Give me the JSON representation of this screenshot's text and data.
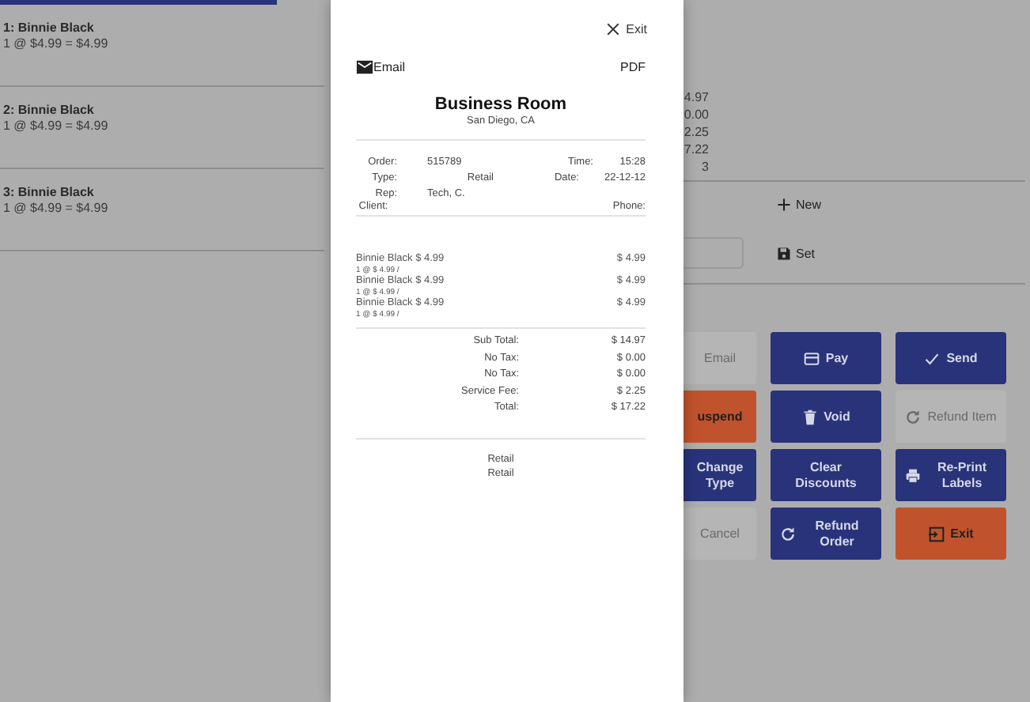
{
  "order_lines": [
    {
      "title": "1: Binnie Black",
      "detail": "1 @ $4.99 = $4.99"
    },
    {
      "title": "2: Binnie Black",
      "detail": "1 @ $4.99 = $4.99"
    },
    {
      "title": "3: Binnie Black",
      "detail": "1 @ $4.99 = $4.99"
    }
  ],
  "summary_values": [
    "4.97",
    "0.00",
    "2.25",
    "7.22",
    "3"
  ],
  "new_action": {
    "label": "New"
  },
  "discount_field": {
    "set_label": "Set"
  },
  "buttons": [
    {
      "label": "Email",
      "kind": "neutral",
      "disabled": true
    },
    {
      "label": "Pay",
      "kind": "primary",
      "disabled": false
    },
    {
      "label": "Send",
      "kind": "primary",
      "disabled": false
    },
    {
      "label": "uspend",
      "kind": "warning",
      "disabled": false
    },
    {
      "label": "Void",
      "kind": "primary",
      "disabled": false
    },
    {
      "label": "Refund Item",
      "kind": "neutral",
      "disabled": true
    },
    {
      "label": "Change Type",
      "kind": "primary",
      "disabled": false
    },
    {
      "label": "Clear Discounts",
      "kind": "primary",
      "disabled": false
    },
    {
      "label": "Re-Print Labels",
      "kind": "primary",
      "disabled": false
    },
    {
      "label": "Cancel",
      "kind": "neutral",
      "disabled": true
    },
    {
      "label": "Refund Order",
      "kind": "primary",
      "disabled": false
    },
    {
      "label": "Exit",
      "kind": "warning",
      "disabled": false
    }
  ],
  "receipt": {
    "close_label": "Exit",
    "email_label": "Email",
    "pdf_label": "PDF",
    "business": "Business Room",
    "location": "San Diego, CA",
    "info_rows": [
      [
        {
          "label": "Order:",
          "value": "515789"
        },
        {
          "label": "Time:",
          "value": "15:28"
        }
      ],
      [
        {
          "label": "Type:",
          "value": "Retail"
        },
        {
          "label": "Date:",
          "value": "22-12-12"
        }
      ],
      [
        {
          "label": "Rep:",
          "value": "Tech, C."
        }
      ],
      [
        {
          "label": "Client:"
        },
        {
          "label": "Phone:"
        }
      ]
    ],
    "items": [
      {
        "name": "Binnie Black $ 4.99",
        "detail": "1 @ $ 4.99 /",
        "amount": "$ 4.99"
      },
      {
        "name": "Binnie Black $ 4.99",
        "detail": "1 @ $ 4.99 /",
        "amount": "$ 4.99"
      },
      {
        "name": "Binnie Black $ 4.99",
        "detail": "1 @ $ 4.99 /",
        "amount": "$ 4.99"
      }
    ],
    "totals": [
      {
        "label": "Sub Total:",
        "value": "$ 14.97"
      },
      {
        "label": "No Tax:",
        "value": "$ 0.00"
      },
      {
        "label": "No Tax:",
        "value": "$ 0.00"
      },
      {
        "label": "Service Fee:",
        "value": "$ 2.25"
      },
      {
        "label": "Total:",
        "value": "$ 17.22"
      }
    ],
    "footer_lines": [
      "Retail",
      "Retail"
    ]
  }
}
